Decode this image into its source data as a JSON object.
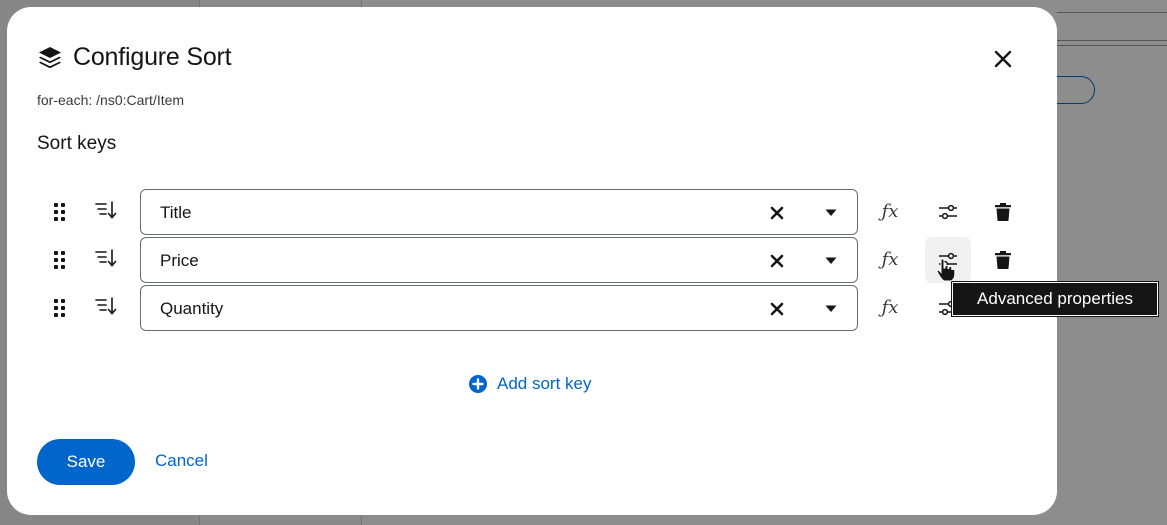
{
  "colors": {
    "accent": "#0066cc",
    "text": "#151515",
    "icon": "#151515",
    "tooltip_bg": "#151515"
  },
  "dialog": {
    "title": "Configure Sort",
    "title_icon": "layers-icon",
    "subtitle": "for-each: /ns0:Cart/Item",
    "section_title": "Sort keys"
  },
  "sort_keys": [
    {
      "value": "Title",
      "sort_icon": "sort-descending-icon"
    },
    {
      "value": "Price",
      "sort_icon": "sort-descending-icon"
    },
    {
      "value": "Quantity",
      "sort_icon": "sort-descending-icon"
    }
  ],
  "row_icons": {
    "drag": "drag-handle-icon",
    "clear": "close-icon",
    "caret": "caret-down-icon",
    "function_glyph": "ƒx",
    "advanced": "sliders-icon",
    "delete": "trash-icon"
  },
  "add_sort_key_label": "Add sort key",
  "footer": {
    "save_label": "Save",
    "cancel_label": "Cancel"
  },
  "tooltip": {
    "text": "Advanced properties"
  }
}
